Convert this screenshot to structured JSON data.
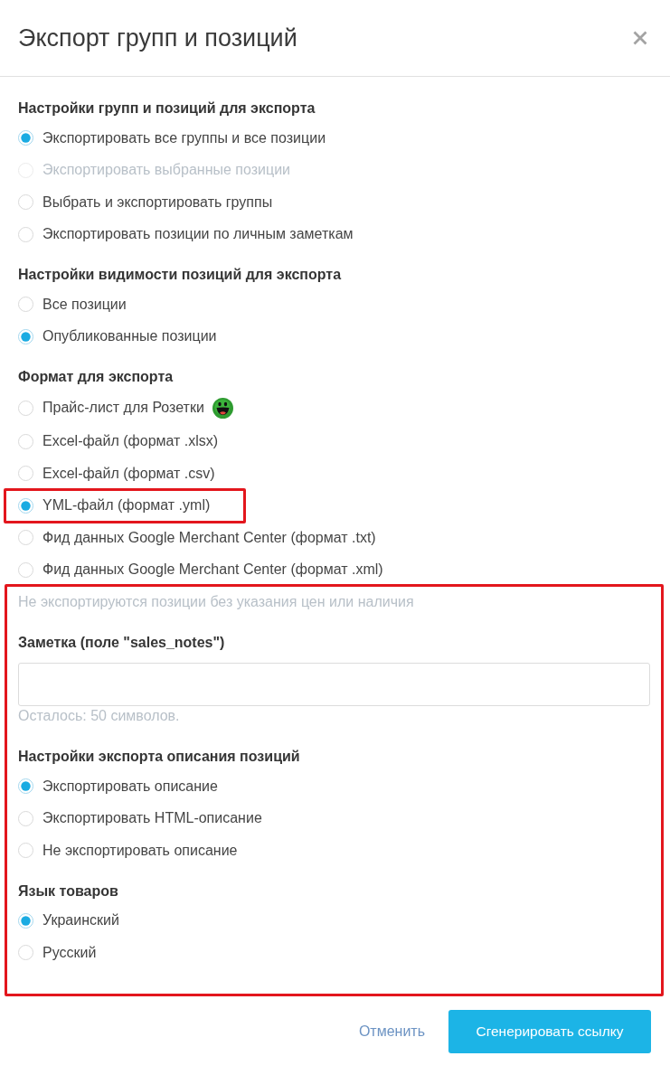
{
  "dialog": {
    "title": "Экспорт групп и позиций"
  },
  "sections": [
    {
      "heading": "Настройки групп и позиций для экспорта",
      "options": [
        {
          "label": "Экспортировать все группы и все позиции",
          "selected": true,
          "disabled": false
        },
        {
          "label": "Экспортировать выбранные позиции",
          "selected": false,
          "disabled": true
        },
        {
          "label": "Выбрать и экспортировать группы",
          "selected": false,
          "disabled": false
        },
        {
          "label": "Экспортировать позиции по личным заметкам",
          "selected": false,
          "disabled": false
        }
      ]
    },
    {
      "heading": "Настройки видимости позиций для экспорта",
      "options": [
        {
          "label": "Все позиции",
          "selected": false
        },
        {
          "label": "Опубликованные позиции",
          "selected": true
        }
      ]
    },
    {
      "heading": "Формат для экспорта",
      "options": [
        {
          "label": "Прайс-лист для Розетки",
          "selected": false,
          "kind": "badge",
          "highlighted": false
        },
        {
          "label": "Excel-файл (формат .xlsx)",
          "selected": false,
          "kind": "plain",
          "highlighted": false
        },
        {
          "label": "Excel-файл (формат .csv)",
          "selected": false,
          "kind": "plain",
          "highlighted": false
        },
        {
          "label": "YML-файл (формат .yml)",
          "selected": true,
          "kind": "plain",
          "highlighted": true
        },
        {
          "label": "Фид данных Google Merchant Center (формат .txt)",
          "selected": false,
          "kind": "plain",
          "highlighted": false
        },
        {
          "label": "Фид данных Google Merchant Center (формат .xml)",
          "selected": false,
          "kind": "plain",
          "highlighted": false
        }
      ]
    }
  ],
  "details_panel": {
    "highlighted": true,
    "note": "Не экспортируются позиции без указания цен или наличия",
    "field": {
      "label": "Заметка (поле \"sales_notes\")",
      "hint": "Осталось: 50 символов."
    },
    "sections": [
      {
        "heading": "Настройки экспорта описания позиций",
        "options": [
          {
            "label": "Экспортировать описание",
            "selected": true
          },
          {
            "label": "Экспортировать HTML-описание",
            "selected": false
          },
          {
            "label": "Не экспортировать описание",
            "selected": false
          }
        ]
      },
      {
        "heading": "Язык товаров",
        "options": [
          {
            "label": "Украинский",
            "selected": true
          },
          {
            "label": "Русский",
            "selected": false
          }
        ]
      }
    ]
  },
  "footer": {
    "cancel": "Отменить",
    "submit": "Сгенерировать ссылку"
  }
}
